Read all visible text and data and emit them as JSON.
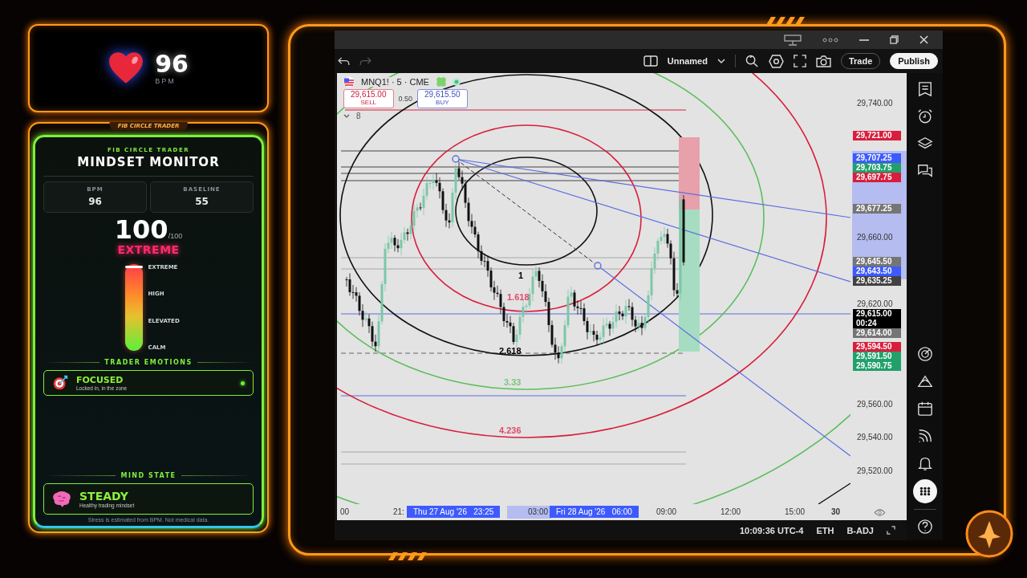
{
  "heart_monitor": {
    "bpm": "96",
    "unit": "BPM"
  },
  "panel": {
    "tab_label": "FIB CIRCLE TRADER",
    "brand": "FIB CIRCLE TRADER",
    "title": "MINDSET MONITOR",
    "stats": [
      {
        "label": "BPM",
        "value": "96"
      },
      {
        "label": "BASELINE",
        "value": "55"
      }
    ],
    "score": "100",
    "score_max": "/100",
    "stress_label": "EXTREME",
    "stress": {
      "level": 0.98,
      "scale": [
        "EXTREME",
        "HIGH",
        "ELEVATED",
        "CALM"
      ]
    },
    "emotions_heading": "TRADER EMOTIONS",
    "emotions": [
      {
        "kind": "target",
        "name": "FOCUSED",
        "note": "Locked in, in the zone",
        "active": true
      }
    ],
    "mind_heading": "MIND STATE",
    "mind_state": {
      "kind": "brain",
      "name": "STEADY",
      "note": "Healthy trading mindset"
    },
    "disclaimer": "Stress is estimated from BPM. Not medical data."
  },
  "chart_window": {
    "toolbar": {
      "layout_name": "Unnamed",
      "buttons": [
        {
          "label": "Trade",
          "kind": "outline"
        },
        {
          "label": "Publish",
          "kind": "solid"
        }
      ]
    },
    "legend": {
      "symbol": "MNQ1! · 5 · CME",
      "sell": {
        "price": "29,615.00",
        "label": "SELL"
      },
      "spread": "0.50",
      "buy": {
        "price": "29,615.50",
        "label": "BUY"
      },
      "indicators": "8"
    },
    "fib_labels": [
      {
        "label": "1",
        "color": "#000000"
      },
      {
        "label": "1.618",
        "color": "#e04a6a"
      },
      {
        "label": "2.618",
        "color": "#000000"
      },
      {
        "label": "3.33",
        "color": "#7cc47c"
      },
      {
        "label": "4.236",
        "color": "#e04a6a"
      }
    ],
    "price_axis": [
      {
        "label": "29,740.00",
        "kind": "tick"
      },
      {
        "label": "29,721.00",
        "kind": "tag",
        "color": "#d81e3c"
      },
      {
        "label": "29,707.25",
        "kind": "tag",
        "color": "#3d5afe"
      },
      {
        "label": "29,703.75",
        "kind": "tag",
        "color": "#22a06b"
      },
      {
        "label": "29,697.75",
        "kind": "tag",
        "color": "#d81e3c"
      },
      {
        "label": "29,677.25",
        "kind": "tag",
        "color": "#757575"
      },
      {
        "label": "29,660.00",
        "kind": "tick"
      },
      {
        "label": "29,645.50",
        "kind": "tag",
        "color": "#757575"
      },
      {
        "label": "29,643.50",
        "kind": "tag",
        "color": "#3d5afe"
      },
      {
        "label": "29,635.25",
        "kind": "tag",
        "color": "#424242"
      },
      {
        "label": "29,620.00",
        "kind": "tick"
      },
      {
        "label": "29,615.00",
        "kind": "tag",
        "color": "#000000",
        "countdown": "00:24"
      },
      {
        "label": "29,614.00",
        "kind": "tag",
        "color": "#757575"
      },
      {
        "label": "29,594.50",
        "kind": "tag",
        "color": "#d81e3c"
      },
      {
        "label": "29,591.50",
        "kind": "tag",
        "color": "#22a06b"
      },
      {
        "label": "29,590.75",
        "kind": "tag",
        "color": "#22a06b"
      },
      {
        "label": "29,560.00",
        "kind": "tick"
      },
      {
        "label": "29,540.00",
        "kind": "tick"
      },
      {
        "label": "29,520.00",
        "kind": "tick"
      }
    ],
    "time_axis": [
      {
        "label": "00",
        "kind": "tick"
      },
      {
        "label": "21:",
        "kind": "tick"
      },
      {
        "label": "Thu 27 Aug '26   23:25",
        "kind": "marker"
      },
      {
        "label": "03:00",
        "kind": "tick"
      },
      {
        "label": "Fri 28 Aug '26   06:00",
        "kind": "marker"
      },
      {
        "label": "09:00",
        "kind": "tick"
      },
      {
        "label": "12:00",
        "kind": "tick"
      },
      {
        "label": "15:00",
        "kind": "tick"
      },
      {
        "label": "30",
        "kind": "bold"
      }
    ],
    "status_bar": [
      "10:09:36 UTC-4",
      "ETH",
      "B-ADJ"
    ],
    "sidebar": [
      {
        "selected": false
      },
      {
        "selected": false
      },
      {
        "selected": false
      },
      {
        "selected": false
      },
      {
        "selected": false
      },
      {
        "selected": false
      },
      {
        "selected": false
      },
      {
        "selected": false
      },
      {
        "selected": false
      },
      {
        "selected": true
      },
      {
        "selected": false
      }
    ]
  }
}
